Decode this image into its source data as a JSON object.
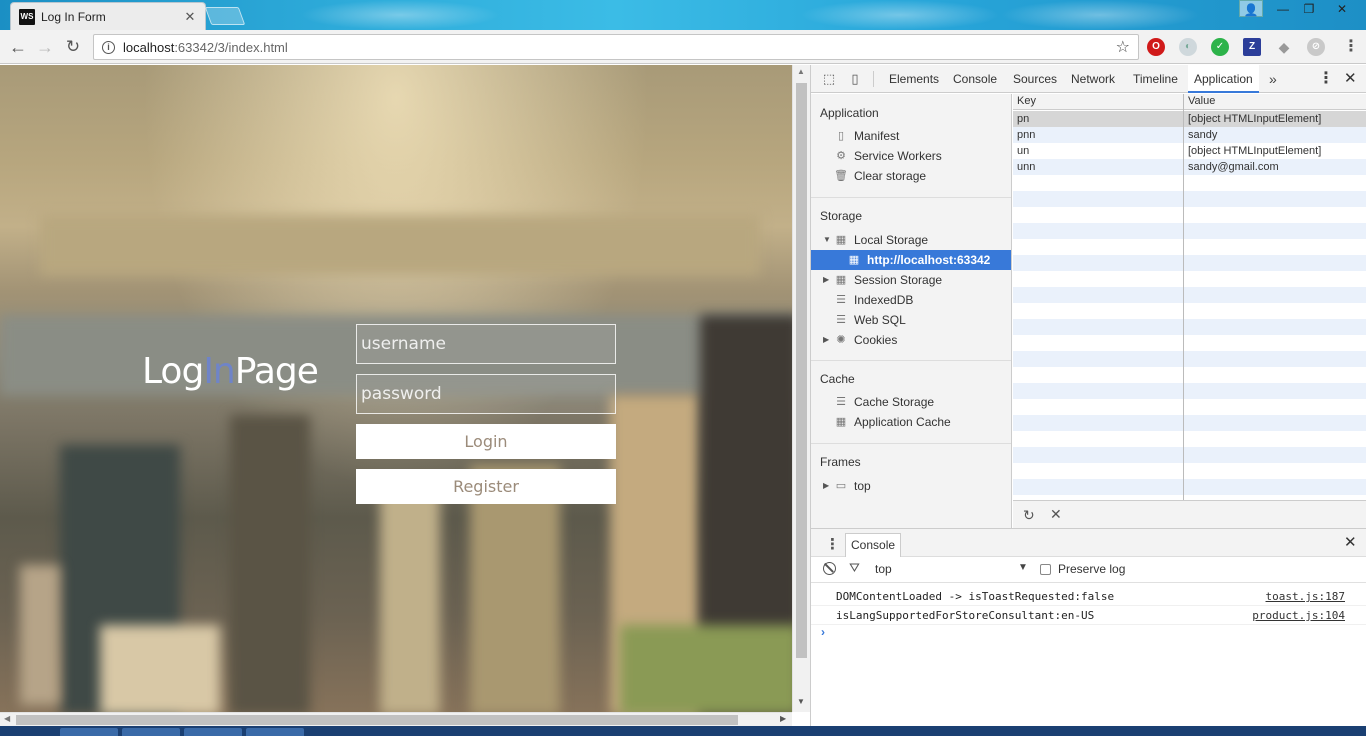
{
  "browser": {
    "tab_title": "Log In Form",
    "tab_icon_text": "WS",
    "url_host": "localhost",
    "url_rest": ":63342/3/index.html"
  },
  "page": {
    "logo_parts": [
      "Log",
      "In",
      "Page"
    ],
    "username_placeholder": "username",
    "password_placeholder": "password",
    "login_label": "Login",
    "register_label": "Register",
    "accent_color": "#6f84c8"
  },
  "devtools": {
    "tabs": [
      "Elements",
      "Console",
      "Sources",
      "Network",
      "Timeline",
      "Application"
    ],
    "active_tab": "Application",
    "more": "»",
    "sidebar": {
      "application": {
        "title": "Application",
        "items": [
          "Manifest",
          "Service Workers",
          "Clear storage"
        ]
      },
      "storage": {
        "title": "Storage",
        "local_storage": "Local Storage",
        "local_storage_origin": "http://localhost:63342",
        "session_storage": "Session Storage",
        "indexeddb": "IndexedDB",
        "websql": "Web SQL",
        "cookies": "Cookies"
      },
      "cache": {
        "title": "Cache",
        "items": [
          "Cache Storage",
          "Application Cache"
        ]
      },
      "frames": {
        "title": "Frames",
        "top": "top"
      }
    },
    "grid": {
      "headers": {
        "key": "Key",
        "value": "Value"
      },
      "rows": [
        {
          "key": "pn",
          "value": "[object HTMLInputElement]"
        },
        {
          "key": "pnn",
          "value": "sandy"
        },
        {
          "key": "un",
          "value": "[object HTMLInputElement]"
        },
        {
          "key": "unn",
          "value": "sandy@gmail.com"
        }
      ]
    },
    "drawer": {
      "tab": "Console",
      "context": "top",
      "preserve_log": "Preserve log",
      "logs": [
        {
          "message": "DOMContentLoaded -> isToastRequested:false",
          "source": "toast.js:187"
        },
        {
          "message": "isLangSupportedForStoreConsultant:en-US",
          "source": "product.js:104"
        }
      ],
      "prompt": "›"
    }
  }
}
